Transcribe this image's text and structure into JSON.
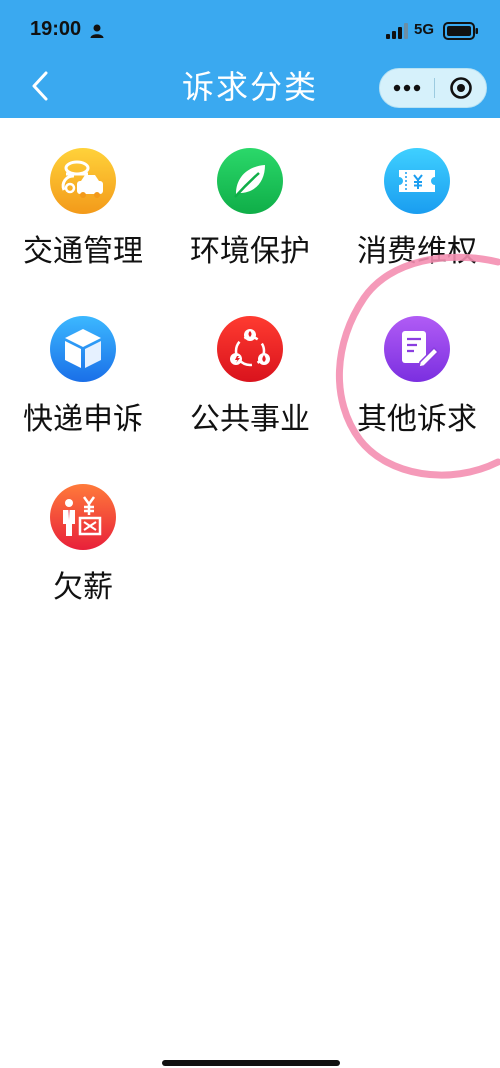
{
  "status_bar": {
    "time": "19:00",
    "network": "5G"
  },
  "nav": {
    "title": "诉求分类"
  },
  "categories": [
    {
      "label": "交通管理",
      "icon": "traffic-icon",
      "color": "#f5a623"
    },
    {
      "label": "环境保护",
      "icon": "leaf-icon",
      "color": "#16c25a"
    },
    {
      "label": "消费维权",
      "icon": "ticket-yen-icon",
      "color": "#1fb8f5"
    },
    {
      "label": "快递申诉",
      "icon": "package-icon",
      "color": "#2a8ef0"
    },
    {
      "label": "公共事业",
      "icon": "utilities-icon",
      "color": "#e61e25"
    },
    {
      "label": "其他诉求",
      "icon": "edit-note-icon",
      "color": "#8a3ee0"
    },
    {
      "label": "欠薪",
      "icon": "wage-icon",
      "color": "#f0402a"
    }
  ],
  "colors": {
    "header": "#3aa9f0",
    "annotation": "#f48fb1"
  }
}
